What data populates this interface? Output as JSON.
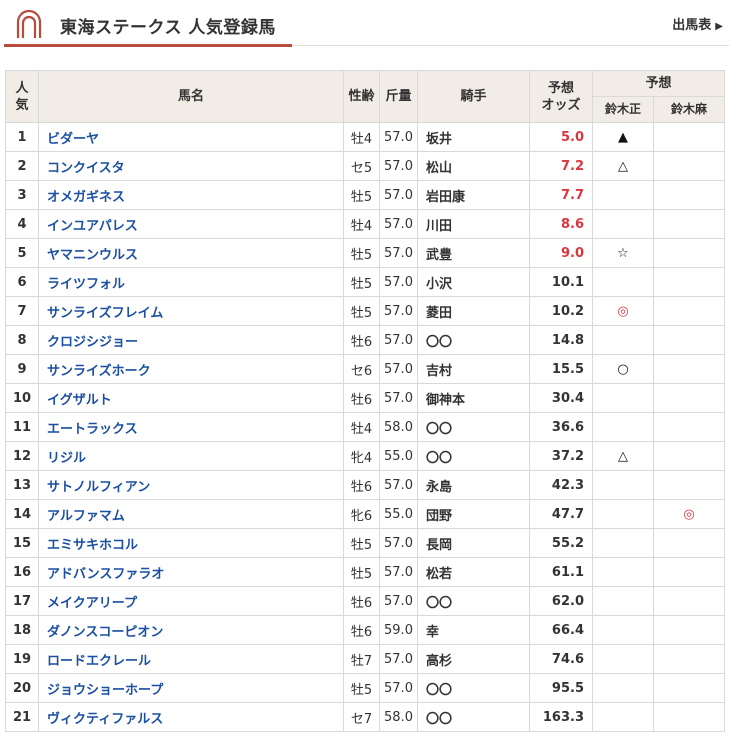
{
  "header": {
    "title": "東海ステークス 人気登録馬",
    "link_label": "出馬表",
    "logo_icon": "horseshoe-icon",
    "accent_color": "#b84a3e"
  },
  "table": {
    "headers": {
      "rank": "人\n気",
      "name": "馬名",
      "sex_age": "性齢",
      "weight": "斤量",
      "jockey": "騎手",
      "odds": "予想\nオッズ",
      "prediction": "予想",
      "predictor1": "鈴木正",
      "predictor2": "鈴木麻"
    },
    "rows": [
      {
        "rank": "1",
        "name": "ビダーヤ",
        "sex_age": "牡4",
        "weight": "57.0",
        "jockey": "坂井",
        "odds": "5.0",
        "hot": true,
        "mark1": "▲",
        "mark2": ""
      },
      {
        "rank": "2",
        "name": "コンクイスタ",
        "sex_age": "セ5",
        "weight": "57.0",
        "jockey": "松山",
        "odds": "7.2",
        "hot": true,
        "mark1": "△",
        "mark2": ""
      },
      {
        "rank": "3",
        "name": "オメガギネス",
        "sex_age": "牡5",
        "weight": "57.0",
        "jockey": "岩田康",
        "odds": "7.7",
        "hot": true,
        "mark1": "",
        "mark2": ""
      },
      {
        "rank": "4",
        "name": "インユアパレス",
        "sex_age": "牡4",
        "weight": "57.0",
        "jockey": "川田",
        "odds": "8.6",
        "hot": true,
        "mark1": "",
        "mark2": ""
      },
      {
        "rank": "5",
        "name": "ヤマニンウルス",
        "sex_age": "牡5",
        "weight": "57.0",
        "jockey": "武豊",
        "odds": "9.0",
        "hot": true,
        "mark1": "☆",
        "mark2": ""
      },
      {
        "rank": "6",
        "name": "ライツフォル",
        "sex_age": "牡5",
        "weight": "57.0",
        "jockey": "小沢",
        "odds": "10.1",
        "hot": false,
        "mark1": "",
        "mark2": ""
      },
      {
        "rank": "7",
        "name": "サンライズフレイム",
        "sex_age": "牡5",
        "weight": "57.0",
        "jockey": "菱田",
        "odds": "10.2",
        "hot": false,
        "mark1": "◎",
        "mark2": ""
      },
      {
        "rank": "8",
        "name": "クロジシジョー",
        "sex_age": "牡6",
        "weight": "57.0",
        "jockey": "〇〇",
        "odds": "14.8",
        "hot": false,
        "mark1": "",
        "mark2": ""
      },
      {
        "rank": "9",
        "name": "サンライズホーク",
        "sex_age": "セ6",
        "weight": "57.0",
        "jockey": "吉村",
        "odds": "15.5",
        "hot": false,
        "mark1": "○",
        "mark2": ""
      },
      {
        "rank": "10",
        "name": "イグザルト",
        "sex_age": "牡6",
        "weight": "57.0",
        "jockey": "御神本",
        "odds": "30.4",
        "hot": false,
        "mark1": "",
        "mark2": ""
      },
      {
        "rank": "11",
        "name": "エートラックス",
        "sex_age": "牡4",
        "weight": "58.0",
        "jockey": "〇〇",
        "odds": "36.6",
        "hot": false,
        "mark1": "",
        "mark2": ""
      },
      {
        "rank": "12",
        "name": "リジル",
        "sex_age": "牝4",
        "weight": "55.0",
        "jockey": "〇〇",
        "odds": "37.2",
        "hot": false,
        "mark1": "△",
        "mark2": ""
      },
      {
        "rank": "13",
        "name": "サトノルフィアン",
        "sex_age": "牡6",
        "weight": "57.0",
        "jockey": "永島",
        "odds": "42.3",
        "hot": false,
        "mark1": "",
        "mark2": ""
      },
      {
        "rank": "14",
        "name": "アルファマム",
        "sex_age": "牝6",
        "weight": "55.0",
        "jockey": "団野",
        "odds": "47.7",
        "hot": false,
        "mark1": "",
        "mark2": "◎"
      },
      {
        "rank": "15",
        "name": "エミサキホコル",
        "sex_age": "牡5",
        "weight": "57.0",
        "jockey": "長岡",
        "odds": "55.2",
        "hot": false,
        "mark1": "",
        "mark2": ""
      },
      {
        "rank": "16",
        "name": "アドバンスファラオ",
        "sex_age": "牡5",
        "weight": "57.0",
        "jockey": "松若",
        "odds": "61.1",
        "hot": false,
        "mark1": "",
        "mark2": ""
      },
      {
        "rank": "17",
        "name": "メイクアリープ",
        "sex_age": "牡6",
        "weight": "57.0",
        "jockey": "〇〇",
        "odds": "62.0",
        "hot": false,
        "mark1": "",
        "mark2": ""
      },
      {
        "rank": "18",
        "name": "ダノンスコーピオン",
        "sex_age": "牡6",
        "weight": "59.0",
        "jockey": "幸",
        "odds": "66.4",
        "hot": false,
        "mark1": "",
        "mark2": ""
      },
      {
        "rank": "19",
        "name": "ロードエクレール",
        "sex_age": "牡7",
        "weight": "57.0",
        "jockey": "高杉",
        "odds": "74.6",
        "hot": false,
        "mark1": "",
        "mark2": ""
      },
      {
        "rank": "20",
        "name": "ジョウショーホープ",
        "sex_age": "牡5",
        "weight": "57.0",
        "jockey": "〇〇",
        "odds": "95.5",
        "hot": false,
        "mark1": "",
        "mark2": ""
      },
      {
        "rank": "21",
        "name": "ヴィクティファルス",
        "sex_age": "セ7",
        "weight": "58.0",
        "jockey": "〇〇",
        "odds": "163.3",
        "hot": false,
        "mark1": "",
        "mark2": ""
      }
    ]
  }
}
